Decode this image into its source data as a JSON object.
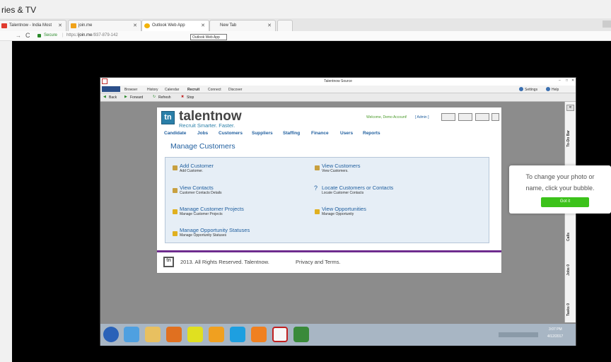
{
  "outer_window_title": "ries & TV",
  "tabs": [
    {
      "label": "Talentnow - India Most",
      "active": false
    },
    {
      "label": "join.me",
      "active": false
    },
    {
      "label": "Outlook Web App",
      "active": true
    },
    {
      "label": "New Tab",
      "active": false
    }
  ],
  "address": {
    "secure_label": "Secure",
    "url_prefix": "https://",
    "url_host": "join.me",
    "url_path": "/937-879-142"
  },
  "tooltip_text": "Outlook Web App",
  "inner_window": {
    "title": "Talentnow Source",
    "menu": [
      "Browser",
      "History",
      "Calendar",
      "Recruit",
      "Connect",
      "Discover"
    ],
    "menu_right": {
      "settings": "Settings",
      "help": "Help"
    },
    "toolbar": {
      "back": "Back",
      "forward": "Forward",
      "refresh": "Refresh",
      "stop": "Stop"
    }
  },
  "page": {
    "logo_name": "talentnow",
    "logo_tagline": "Recruit Smarter. Faster.",
    "welcome": "Welcome, Demo Account!",
    "admin": "[ Admin ]",
    "nav": [
      "Candidate",
      "Jobs",
      "Customers",
      "Suppliers",
      "Staffing",
      "Finance",
      "Users",
      "Reports"
    ],
    "heading": "Manage Customers",
    "left_links": [
      {
        "title": "Add Customer",
        "sub": "Add Customer."
      },
      {
        "title": "View Contacts",
        "sub": "Customer Contacts Details"
      },
      {
        "title": "Manage Customer Projects",
        "sub": "Manage Customer Projects"
      },
      {
        "title": "Manage Opportunity Statuses",
        "sub": "Manage Opportunity Statuses"
      }
    ],
    "right_links": [
      {
        "title": "View Customers",
        "sub": "View Customers."
      },
      {
        "title": "Locate Customers or Contacts",
        "sub": "Locate Customer Contacts"
      },
      {
        "title": "View Opportunities",
        "sub": "Manage Opportunity"
      }
    ],
    "footer": "2013. All Rights Reserved. Talentnow.",
    "footer_links": "Privacy and Terms."
  },
  "side_panel": {
    "todo": "To-Do Bar",
    "calls": "Calls",
    "jobs": "Jobs 0",
    "tasks": "Tasks 0"
  },
  "popup": {
    "line1": "To change your photo or",
    "line2": "name, click your bubble.",
    "button": "Got it",
    "button_color": "#3cc21a"
  },
  "taskbar": {
    "time": "3:07 PM",
    "date": "4/12/2017"
  },
  "colors": {
    "nav_blue": "#1f5e9e",
    "brand_purple": "#6e2c8e",
    "logo_teal": "#2a7fa8"
  }
}
